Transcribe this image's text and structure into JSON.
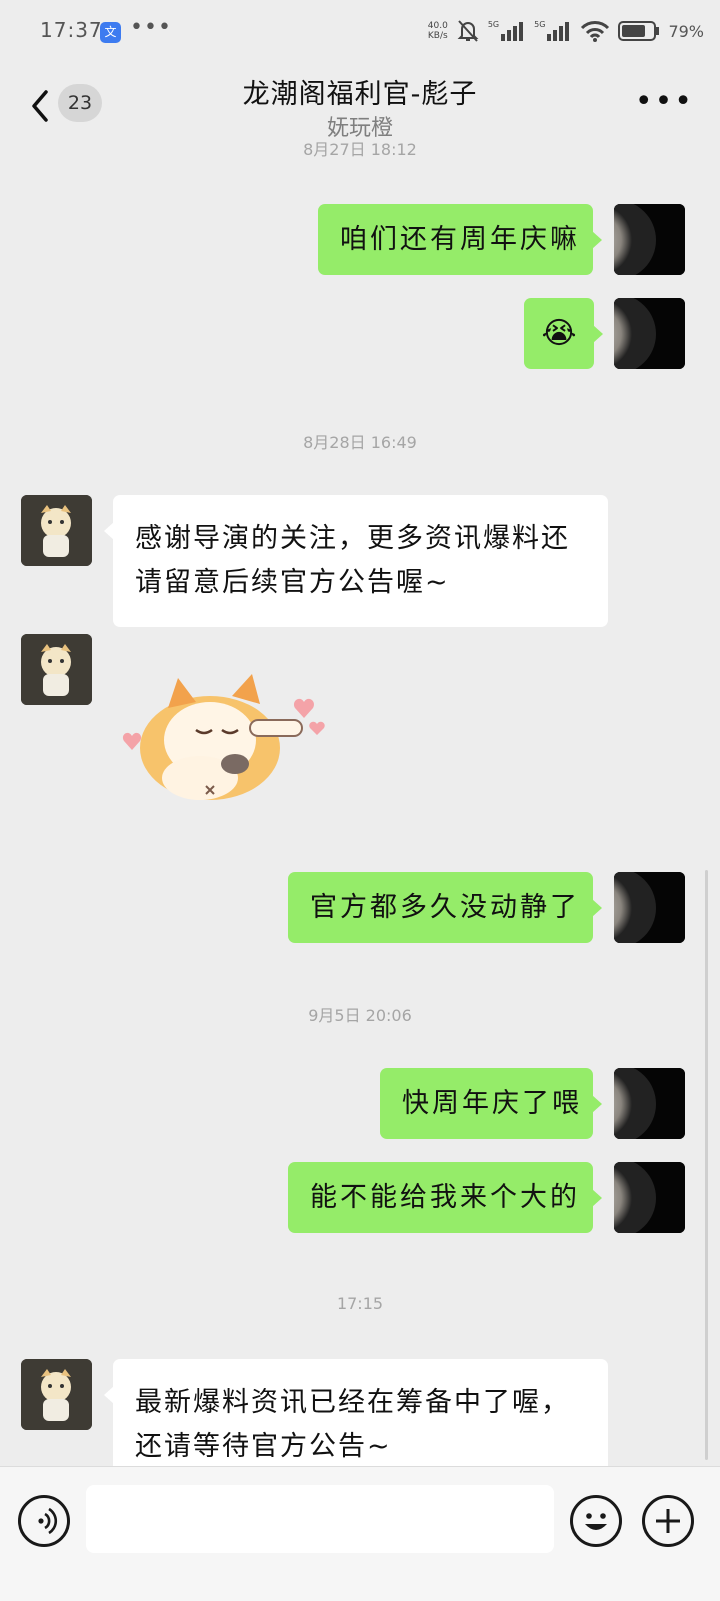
{
  "status_bar": {
    "time": "17:37",
    "app_icon": "文",
    "dots": "•••",
    "net_speed_value": "40.0",
    "net_speed_unit": "KB/s",
    "sim1": "5G",
    "sim2": "5G",
    "battery": "79%",
    "icons": [
      "mute-bell-icon",
      "signal-icon",
      "wifi-icon",
      "battery-icon"
    ]
  },
  "header": {
    "back_count": "23",
    "title": "龙潮阁福利官-彪子",
    "subtitle": "妩玩橙",
    "more": "•••",
    "partial_timestamp": "8月27日 18:12"
  },
  "messages": [
    {
      "from": "me",
      "text": "咱们还有周年庆嘛"
    },
    {
      "from": "me",
      "emoji": "😭",
      "emoji_name": "crying-emoji"
    },
    {
      "timestamp": "8月28日 16:49"
    },
    {
      "from": "bot",
      "lines": [
        "感谢导演的关注，更多资讯爆料还",
        "请留意后续官方公告喔~"
      ]
    },
    {
      "from": "bot",
      "sticker": "fox-sticker"
    },
    {
      "from": "me",
      "text": "官方都多久没动静了"
    },
    {
      "timestamp": "9月5日 20:06"
    },
    {
      "from": "me",
      "text": "快周年庆了喂"
    },
    {
      "from": "me",
      "text": "能不能给我来个大的"
    },
    {
      "timestamp": "17:15"
    },
    {
      "from": "bot",
      "lines": [
        "最新爆料资讯已经在筹备中了喔，",
        "还请等待官方公告~"
      ]
    }
  ],
  "colors": {
    "background": "#ededed",
    "sent_bubble": "#95ec69",
    "received_bubble": "#ffffff",
    "timestamp": "#a5a5a5"
  }
}
